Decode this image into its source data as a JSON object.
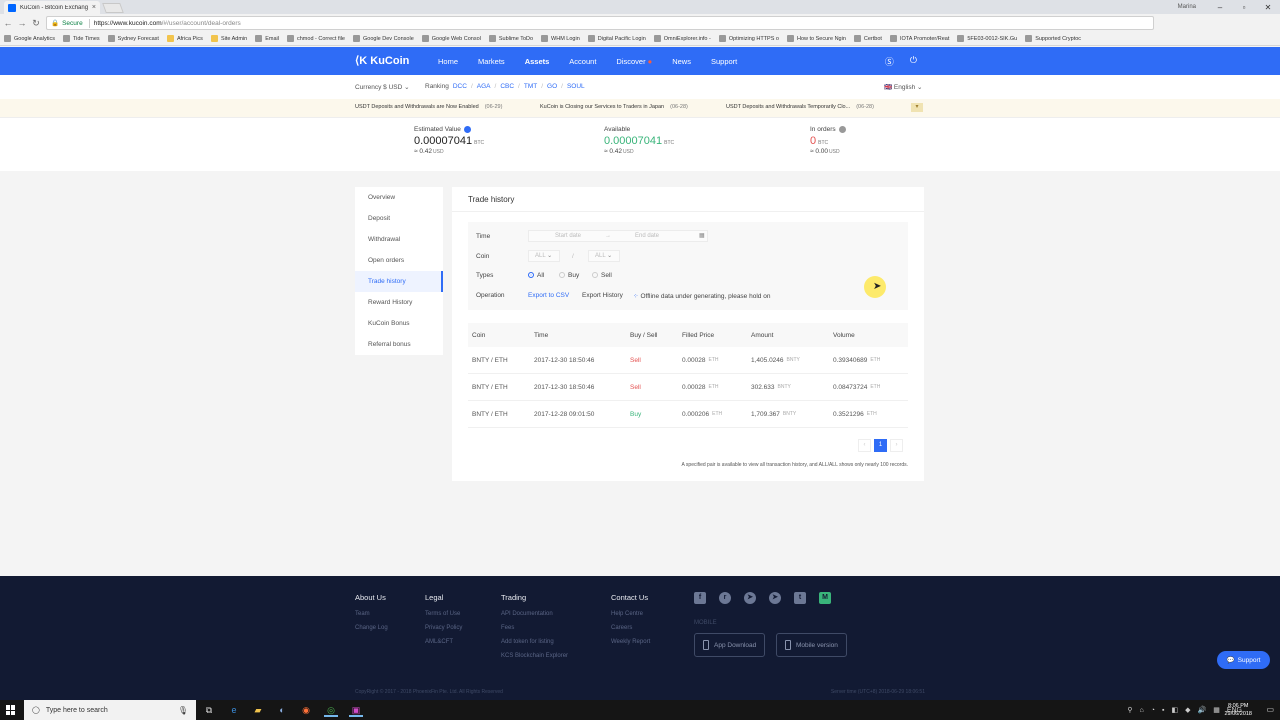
{
  "browser": {
    "tab_title": "KuCoin - Bitcoin Exchang",
    "user": "Marina",
    "secure_label": "Secure",
    "url_host": "https://www.kucoin.com",
    "url_path": "/#/user/account/deal-orders",
    "bookmarks": [
      "Google Analytics",
      "Tide Times",
      "Sydney Forecast",
      "Africa Pics",
      "Site Admin",
      "Email",
      "chmod - Correct file",
      "Google Dev Console",
      "Google Web Consol",
      "Sublime ToDo",
      "WHM Login",
      "Digital Pacific Login",
      "OmniExplorer.info -",
      "Optimizing HTTPS o",
      "How to Secure Ngin",
      "Certbot",
      "IOTA Promoter/Reat",
      "5FE03-0012-SIK.Gu",
      "Supported Cryptoc"
    ]
  },
  "header": {
    "logo": "KuCoin",
    "nav": [
      "Home",
      "Markets",
      "Assets",
      "Account",
      "Discover",
      "News",
      "Support"
    ],
    "active": "Assets"
  },
  "subbar": {
    "currency": "Currency  $ USD",
    "ranking_label": "Ranking",
    "ranking": [
      "DCC",
      "AGA",
      "CBC",
      "TMT",
      "GO",
      "SOUL"
    ],
    "language": "English"
  },
  "notices": [
    {
      "text": "USDT Deposits and Withdrawals are Now Enabled",
      "date": "(06-29)"
    },
    {
      "text": "KuCoin is Closing our Services to Traders in Japan",
      "date": "(06-28)"
    },
    {
      "text": "USDT Deposits and Withdrawals Temporarily Clo...",
      "date": "(06-28)"
    }
  ],
  "balances": {
    "estimated": {
      "label": "Estimated Value",
      "value": "0.00007041",
      "unit": "BTC",
      "usd": "≈ 0.42",
      "usd_unit": "USD"
    },
    "available": {
      "label": "Available",
      "value": "0.00007041",
      "unit": "BTC",
      "usd": "≈ 0.42",
      "usd_unit": "USD"
    },
    "in_orders": {
      "label": "In orders",
      "value": "0",
      "unit": "BTC",
      "usd": "≈ 0.00",
      "usd_unit": "USD"
    }
  },
  "sidemenu": [
    "Overview",
    "Deposit",
    "Withdrawal",
    "Open orders",
    "Trade history",
    "Reward History",
    "KuCoin Bonus",
    "Referral bonus"
  ],
  "sidemenu_active": "Trade history",
  "panel": {
    "title": "Trade history",
    "filters": {
      "time_label": "Time",
      "start_placeholder": "Start date",
      "end_placeholder": "End date",
      "coin_label": "Coin",
      "coin_a": "ALL",
      "coin_b": "ALL",
      "coin_sep": "/",
      "types_label": "Types",
      "types": [
        "All",
        "Buy",
        "Sell"
      ],
      "types_selected": "All",
      "operation_label": "Operation",
      "export_csv": "Export to CSV",
      "export_history": "Export History",
      "offline_note": "Offline data under generating, please hold on"
    },
    "columns": [
      "Coin",
      "Time",
      "Buy / Sell",
      "Filled Price",
      "Amount",
      "Volume"
    ],
    "rows": [
      {
        "coin": "BNTY / ETH",
        "time": "2017-12-30 18:50:46",
        "side": "Sell",
        "price": "0.00028",
        "price_unit": "ETH",
        "amount": "1,405.0246",
        "amount_unit": "BNTY",
        "volume": "0.39340689",
        "volume_unit": "ETH"
      },
      {
        "coin": "BNTY / ETH",
        "time": "2017-12-30 18:50:46",
        "side": "Sell",
        "price": "0.00028",
        "price_unit": "ETH",
        "amount": "302.633",
        "amount_unit": "BNTY",
        "volume": "0.08473724",
        "volume_unit": "ETH"
      },
      {
        "coin": "BNTY / ETH",
        "time": "2017-12-28 09:01:50",
        "side": "Buy",
        "price": "0.000206",
        "price_unit": "ETH",
        "amount": "1,709.367",
        "amount_unit": "BNTY",
        "volume": "0.3521296",
        "volume_unit": "ETH"
      }
    ],
    "pager": {
      "prev": "‹",
      "current": "1",
      "next": "›"
    },
    "note": "A specified pair is available to view all transaction history, and ALL/ALL shows only nearly 100 records."
  },
  "footer": {
    "cols": [
      {
        "h": "About Us",
        "links": [
          "Team",
          "Change Log"
        ]
      },
      {
        "h": "Legal",
        "links": [
          "Terms of Use",
          "Privacy Policy",
          "AML&CFT"
        ]
      },
      {
        "h": "Trading",
        "links": [
          "API Documentation",
          "Fees",
          "Add token for listing",
          "KCS Blockchain Explorer"
        ]
      },
      {
        "h": "Contact Us",
        "links": [
          "Help Centre",
          "Careers",
          "Weekly Report"
        ]
      }
    ],
    "mobile_label": "MOBILE",
    "app_download": "App Download",
    "mobile_version": "Mobile version",
    "copyright": "CopyRight © 2017 - 2018 PhoenixFin Pte. Ltd. All Rights Reserved",
    "server_time": "Server time (UTC+8) 2018-06-29 18:06:51",
    "support": "Support"
  },
  "taskbar": {
    "search_placeholder": "Type here to search",
    "lang": "ENG",
    "time": "8:06 PM",
    "date": "29/06/2018"
  },
  "colors": {
    "brand": "#2f6cf6",
    "sell": "#e4504f",
    "buy": "#39b47a",
    "footer_bg": "#121a33"
  }
}
